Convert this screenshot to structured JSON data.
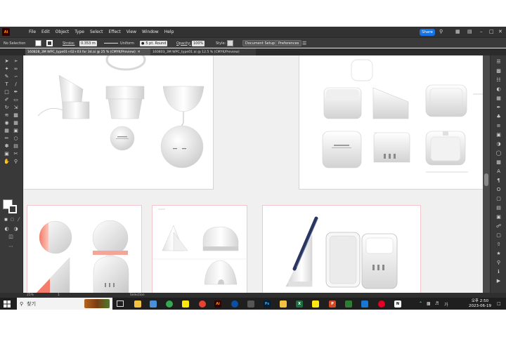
{
  "app": {
    "logo_text": "Ai"
  },
  "menu": {
    "items": [
      "File",
      "Edit",
      "Object",
      "Type",
      "Select",
      "Effect",
      "View",
      "Window",
      "Help"
    ],
    "share_label": "Share"
  },
  "control_bar": {
    "selection_label": "No Selection",
    "stroke_label": "Stroke:",
    "stroke_value": "0.353 m",
    "profile_label": "Uniform",
    "brush_label": "5 pt. Round",
    "opacity_label": "Opacity:",
    "opacity_value": "100%",
    "style_label": "Style:",
    "document_setup_label": "Document Setup",
    "preferences_label": "Preferences"
  },
  "tabs": [
    {
      "label": "160828_3M WPC_type01+02+03 for 3d.ai @ 25 % (CMYK/Preview)",
      "active": true
    },
    {
      "label": "160803_3M WPC_type01.ai @ 12.5 % (CMYK/Preview)",
      "active": false
    }
  ],
  "status_bar": {
    "zoom": "25%",
    "page": "1",
    "tool": "Selection"
  },
  "taskbar": {
    "search_placeholder": "찾기",
    "time": "오후 2:50",
    "date": "2023-06-19",
    "ime": "가",
    "apps": [
      {
        "name": "file-explorer",
        "color": "#f3c240",
        "label": ""
      },
      {
        "name": "chrome",
        "color": "#34a853",
        "label": ""
      },
      {
        "name": "kakaotalk",
        "color": "#ffe812",
        "label": ""
      },
      {
        "name": "chrome-2",
        "color": "#e94235",
        "label": ""
      },
      {
        "name": "illustrator",
        "color": "#ff9a00",
        "label": "Ai"
      },
      {
        "name": "photoshop",
        "color": "#31a8ff",
        "label": "Ps"
      },
      {
        "name": "files",
        "color": "#f3c240",
        "label": ""
      },
      {
        "name": "excel",
        "color": "#1d6f42",
        "label": "X"
      },
      {
        "name": "powerpoint",
        "color": "#d24726",
        "label": "P"
      },
      {
        "name": "notion",
        "color": "#ffffff",
        "label": "N"
      }
    ]
  }
}
